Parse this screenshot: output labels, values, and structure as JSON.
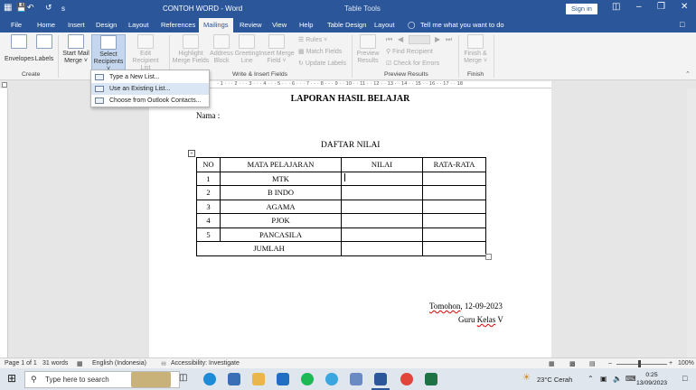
{
  "titlebar": {
    "autosave": "s",
    "doc_title": "CONTOH WORD  -  Word",
    "context_tab": "Table Tools",
    "signin": "Sign in"
  },
  "tabs": [
    "File",
    "Home",
    "Insert",
    "Design",
    "Layout",
    "References",
    "Mailings",
    "Review",
    "View",
    "Help",
    "Table Design",
    "Layout"
  ],
  "tellme": "Tell me what you want to do",
  "ribbon": {
    "envelopes": "Envelopes",
    "labels": "Labels",
    "start_mail_merge": [
      "Start Mail",
      "Merge ˅"
    ],
    "select_recipients": [
      "Select",
      "Recipients ˅"
    ],
    "edit_recipient_list": [
      "Edit",
      "Recipient List"
    ],
    "highlight_merge_fields": [
      "Highlight",
      "Merge Fields"
    ],
    "address_block": [
      "Address",
      "Block"
    ],
    "greeting_line": [
      "Greeting",
      "Line"
    ],
    "insert_merge_field": [
      "Insert Merge",
      "Field ˅"
    ],
    "rules": "Rules ˅",
    "match_fields": "Match Fields",
    "update_labels": "Update Labels",
    "preview_results": [
      "Preview",
      "Results"
    ],
    "find_recipient": "Find Recipient",
    "check_for_errors": "Check for Errors",
    "finish_merge": [
      "Finish &",
      "Merge ˅"
    ],
    "groups": {
      "create": "Create",
      "write_insert": "Write & Insert Fields",
      "preview": "Preview Results",
      "finish": "Finish"
    }
  },
  "dropdown": [
    "Type a New List...",
    "Use an Existing List...",
    "Choose from Outlook Contacts..."
  ],
  "ruler": "· 1 · · · 2 · · · 3 · · · 4 · · · 5 · · · 6 · · · 7 · · · 8 · · · 9 · · 10 · · 11 · · 12 · · 13 · · 14 · · 15 · · 16 · · 17 · · 18",
  "document": {
    "title": "LAPORAN HASIL BELAJAR",
    "nama": "Nama  :",
    "subtitle": "DAFTAR NILAI",
    "headers": [
      "NO",
      "MATA PELAJARAN",
      "NILAI",
      "RATA-RATA"
    ],
    "rows": [
      [
        "1",
        "MTK",
        "",
        ""
      ],
      [
        "2",
        "B INDO",
        "",
        ""
      ],
      [
        "3",
        "AGAMA",
        "",
        ""
      ],
      [
        "4",
        "PJOK",
        "",
        ""
      ],
      [
        "5",
        "PANCASILA",
        "",
        ""
      ]
    ],
    "jumlah": "JUMLAH",
    "place": "Tomohon",
    "date": ", 12-09-2023",
    "guru_pre": "Guru ",
    "guru_kelas": "Kelas",
    "guru_post": " V"
  },
  "status": {
    "page": "Page 1 of 1",
    "words": "31 words",
    "language": "English (Indonesia)",
    "accessibility": "Accessibility: Investigate",
    "zoom": "100%"
  },
  "taskbar": {
    "search": "Type here to search",
    "weather": "23°C  Cerah",
    "time": "0:25",
    "date": "13/09/2023"
  }
}
